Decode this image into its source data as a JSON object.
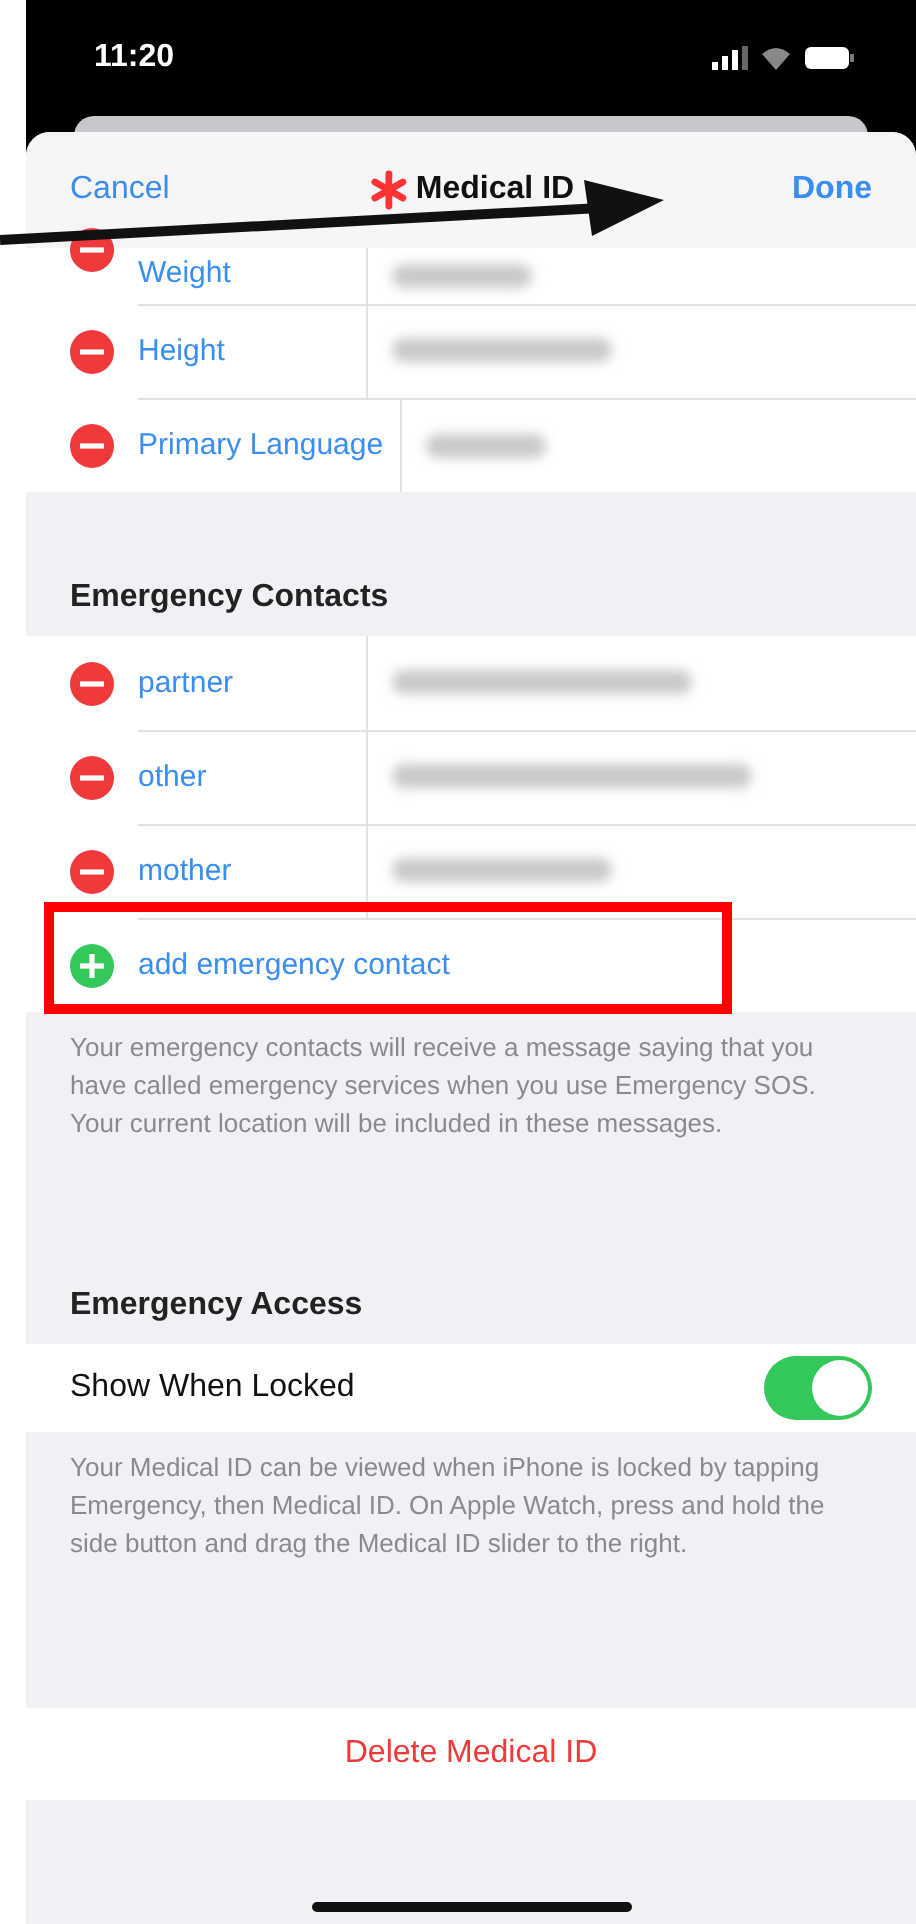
{
  "status_bar": {
    "time": "11:20"
  },
  "nav": {
    "cancel": "Cancel",
    "title": "Medical ID",
    "done": "Done"
  },
  "medical_rows": [
    {
      "label": "Weight",
      "kind": "remove",
      "redacted": true
    },
    {
      "label": "Height",
      "kind": "remove",
      "redacted": true
    },
    {
      "label": "Primary Language",
      "kind": "remove",
      "redacted": true
    }
  ],
  "emergency_contacts": {
    "header": "Emergency Contacts",
    "rows": [
      {
        "label": "partner",
        "kind": "remove",
        "redacted": true
      },
      {
        "label": "other",
        "kind": "remove",
        "redacted": true
      },
      {
        "label": "mother",
        "kind": "remove",
        "redacted": true
      },
      {
        "label": "add emergency contact",
        "kind": "add",
        "redacted": false,
        "highlighted": true
      }
    ],
    "footer": "Your emergency contacts will receive a message saying that you have called emergency services when you use Emergency SOS. Your current location will be included in these messages."
  },
  "emergency_access": {
    "header": "Emergency Access",
    "toggle_label": "Show When Locked",
    "on": true,
    "footer": "Your Medical ID can be viewed when iPhone is locked by tapping Emergency, then Medical ID. On Apple Watch, press and hold the side button and drag the Medical ID slider to the right."
  },
  "delete_button": "Delete Medical ID"
}
